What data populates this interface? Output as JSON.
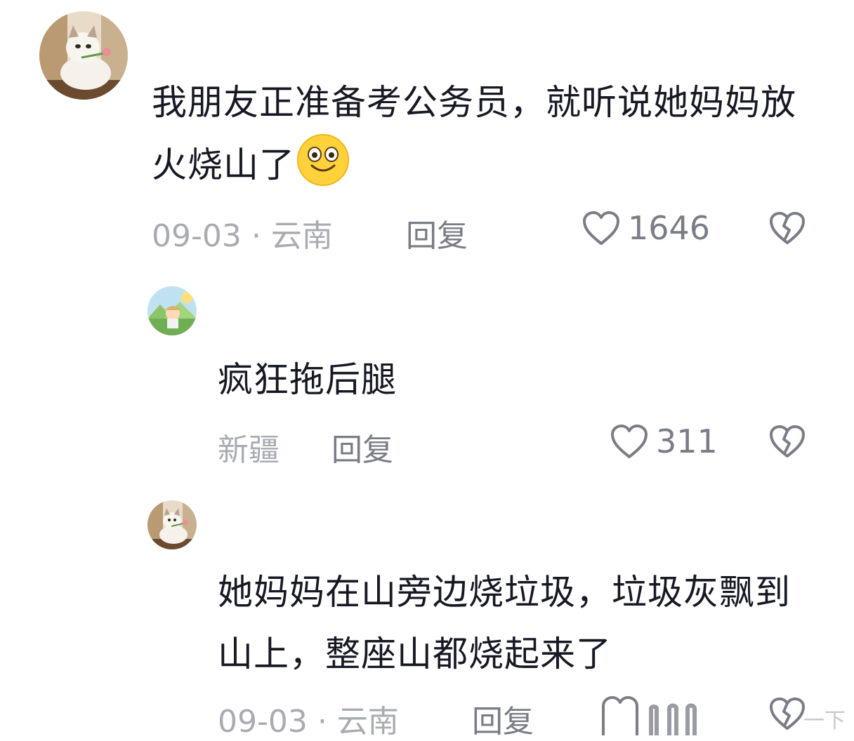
{
  "comments": [
    {
      "text": "我朋友正准备考公务员，就听说她妈妈放火烧山了",
      "meta": "09-03 · 云南",
      "reply_label": "回复",
      "likes": "1646",
      "emoji": "smile-emoji"
    },
    {
      "text": "疯狂拖后腿",
      "meta": "新疆",
      "reply_label": "回复",
      "likes": "311"
    },
    {
      "text": "她妈妈在山旁边烧垃圾，垃圾灰飘到山上，整座山都烧起来了",
      "meta": "09-03 · 云南",
      "reply_label": "回复"
    }
  ],
  "icons": {
    "like": "heart-outline-icon",
    "dislike": "broken-heart-icon"
  },
  "colors": {
    "text": "#161823",
    "meta": "#a9abb3",
    "action": "#7a7c86"
  },
  "watermark": "一下"
}
